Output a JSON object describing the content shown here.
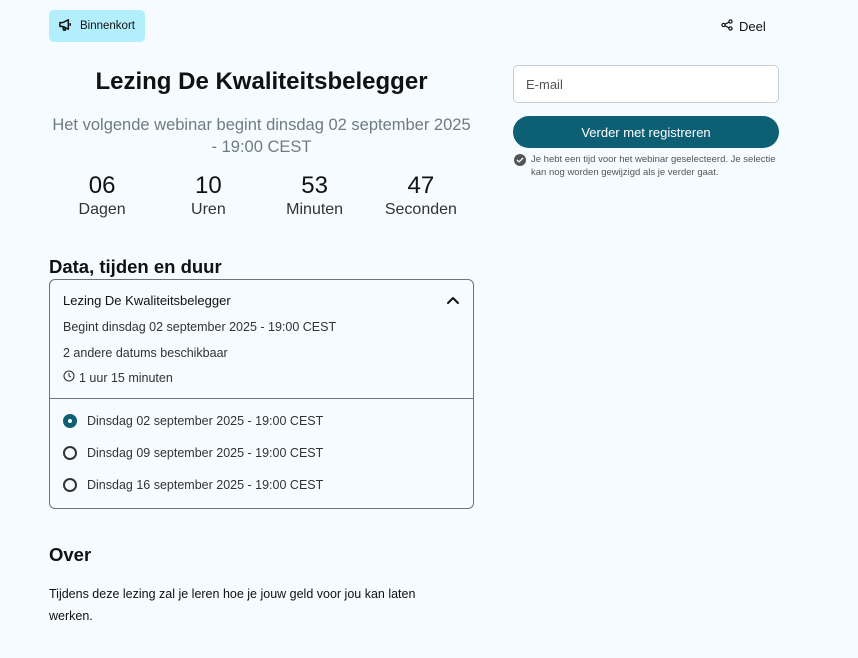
{
  "badge": {
    "label": "Binnenkort",
    "icon": "megaphone-icon"
  },
  "share": {
    "label": "Deel",
    "icon": "share-icon"
  },
  "event": {
    "title": "Lezing De Kwaliteitsbelegger",
    "subtitle": "Het volgende webinar begint dinsdag 02 september 2025 - 19:00 CEST"
  },
  "countdown": [
    {
      "value": "06",
      "label": "Dagen"
    },
    {
      "value": "10",
      "label": "Uren"
    },
    {
      "value": "53",
      "label": "Minuten"
    },
    {
      "value": "47",
      "label": "Seconden"
    }
  ],
  "schedule": {
    "heading": "Data, tijden en duur",
    "card_title": "Lezing De Kwaliteitsbelegger",
    "starts": "Begint dinsdag 02 september 2025 - 19:00 CEST",
    "other_dates": "2 andere datums beschikbaar",
    "duration": "1 uur 15 minuten",
    "options": [
      {
        "label": "Dinsdag 02 september 2025 - 19:00 CEST",
        "selected": true
      },
      {
        "label": "Dinsdag 09 september 2025 - 19:00 CEST",
        "selected": false
      },
      {
        "label": "Dinsdag 16 september 2025 - 19:00 CEST",
        "selected": false
      }
    ]
  },
  "about": {
    "heading": "Over",
    "text": "Tijdens deze lezing zal je leren hoe je jouw geld voor jou kan laten werken."
  },
  "registration": {
    "email_placeholder": "E-mail",
    "email_value": "",
    "button_label": "Verder met registreren",
    "note": "Je hebt een tijd voor het webinar geselecteerd. Je selectie kan nog worden gewijzigd als je verder gaat."
  },
  "colors": {
    "accent": "#0d5f74",
    "badge_bg": "#b3eefc",
    "background": "#f5fbfe"
  }
}
